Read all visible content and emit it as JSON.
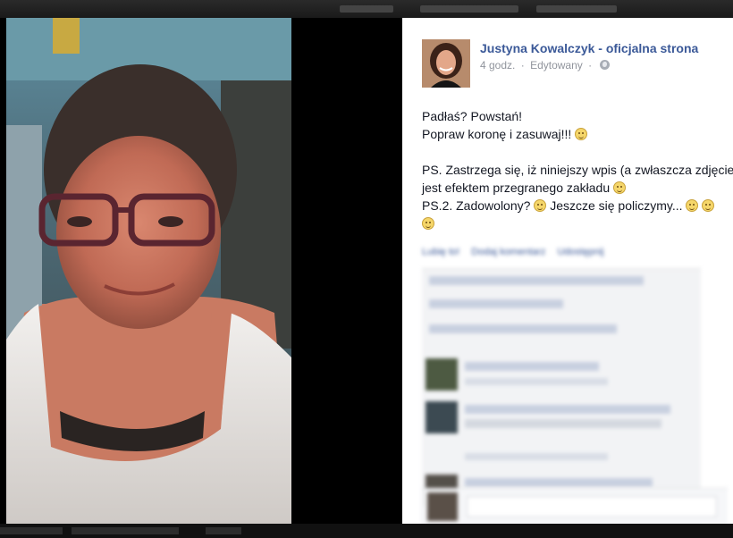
{
  "post": {
    "page_name": "Justyna Kowalczyk - oficjalna strona",
    "time": "4 godz.",
    "separator": "·",
    "edited": "Edytowany",
    "privacy_icon": "globe-icon",
    "lines": [
      "Padłaś? Powstań!",
      "Popraw koronę i zasuwaj!!!",
      "PS. Zastrzega się, iż niniejszy wpis (a zwłaszcza zdjęcie)",
      "jest efektem przegranego zakładu",
      "PS.2. Zadowolony?",
      "Jeszcze się policzymy..."
    ]
  },
  "actions": {
    "like": "Lubię to!",
    "comment": "Dodaj komentarz",
    "share": "Udostępnij"
  },
  "colors": {
    "link_blue": "#3b5998",
    "meta_grey": "#90949c",
    "text": "#141823",
    "panel_bg": "#ffffff",
    "overlay_bg": "#000000"
  }
}
